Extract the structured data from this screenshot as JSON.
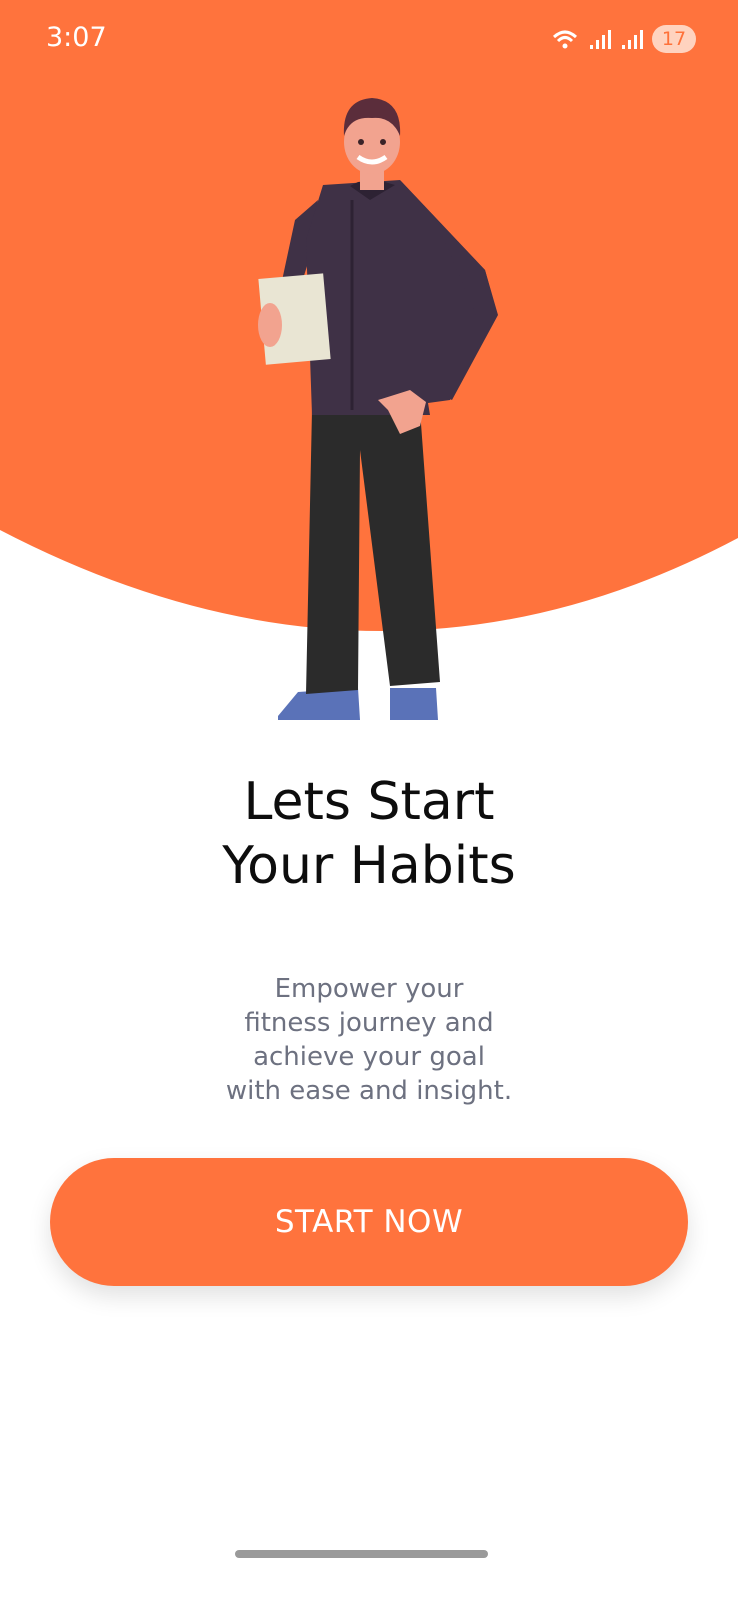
{
  "status_bar": {
    "time": "3:07",
    "battery": "17",
    "icons": [
      "wifi-icon",
      "signal-icon",
      "signal-icon"
    ]
  },
  "hero": {
    "background_color": "#ff733d",
    "illustration": "man-holding-paper-illustration"
  },
  "title": {
    "line1": "Lets Start",
    "line2": "Your Habits"
  },
  "subtitle": {
    "line1": "Empower your",
    "line2": "fitness journey and",
    "line3": "achieve your goal",
    "line4": "with ease and insight."
  },
  "cta": {
    "label": "START NOW",
    "color": "#ff733d"
  }
}
